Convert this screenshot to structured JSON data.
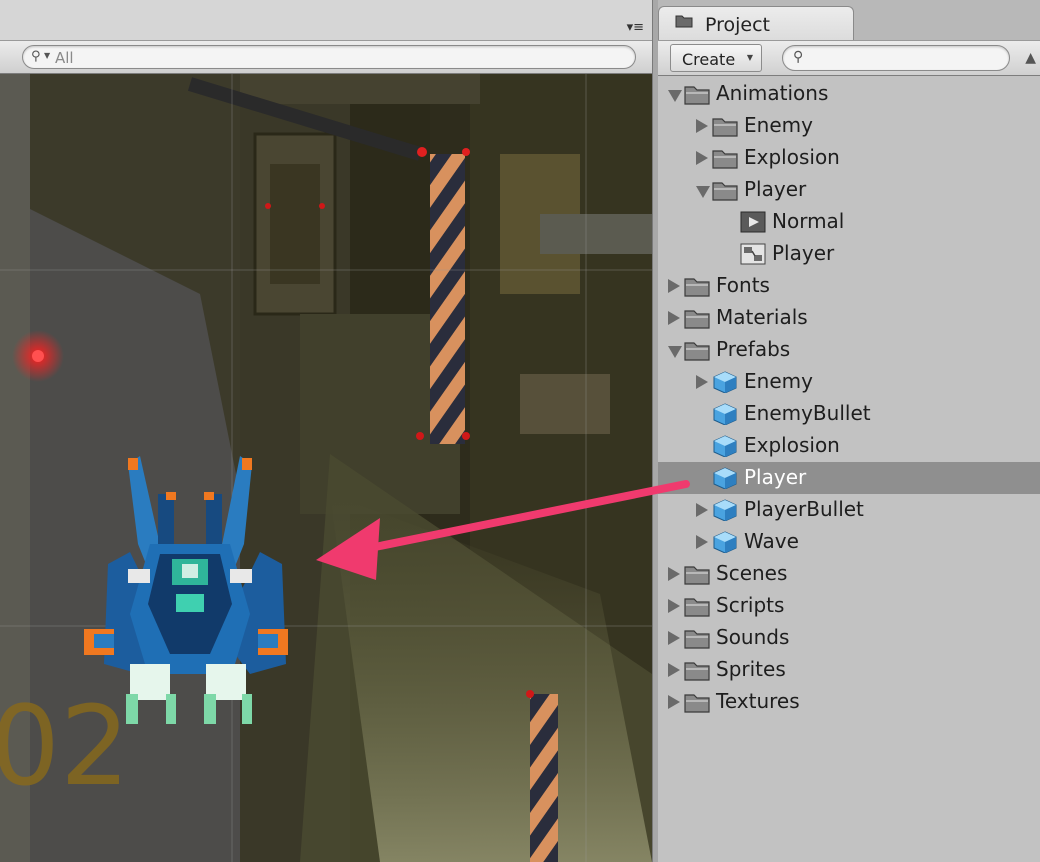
{
  "scene": {
    "search_placeholder": "All",
    "panel_menu": "▾≡",
    "runway_marking": "02"
  },
  "project": {
    "tab_label": "Project",
    "create_label": "Create",
    "search_placeholder": "",
    "tree": [
      {
        "label": "Animations",
        "depth": 0,
        "icon": "folder-icon",
        "toggle": "open"
      },
      {
        "label": "Enemy",
        "depth": 1,
        "icon": "folder-icon",
        "toggle": "closed"
      },
      {
        "label": "Explosion",
        "depth": 1,
        "icon": "folder-icon",
        "toggle": "closed"
      },
      {
        "label": "Player",
        "depth": 1,
        "icon": "folder-icon",
        "toggle": "open"
      },
      {
        "label": "Normal",
        "depth": 2,
        "icon": "animation-clip-icon",
        "toggle": "none"
      },
      {
        "label": "Player",
        "depth": 2,
        "icon": "animator-controller-icon",
        "toggle": "none"
      },
      {
        "label": "Fonts",
        "depth": 0,
        "icon": "folder-icon",
        "toggle": "closed"
      },
      {
        "label": "Materials",
        "depth": 0,
        "icon": "folder-icon",
        "toggle": "closed"
      },
      {
        "label": "Prefabs",
        "depth": 0,
        "icon": "folder-icon",
        "toggle": "open"
      },
      {
        "label": "Enemy",
        "depth": 1,
        "icon": "prefab-cube-icon",
        "toggle": "closed"
      },
      {
        "label": "EnemyBullet",
        "depth": 1,
        "icon": "prefab-cube-icon",
        "toggle": "none"
      },
      {
        "label": "Explosion",
        "depth": 1,
        "icon": "prefab-cube-icon",
        "toggle": "none"
      },
      {
        "label": "Player",
        "depth": 1,
        "icon": "prefab-cube-icon",
        "toggle": "none",
        "selected": true
      },
      {
        "label": "PlayerBullet",
        "depth": 1,
        "icon": "prefab-cube-icon",
        "toggle": "closed"
      },
      {
        "label": "Wave",
        "depth": 1,
        "icon": "prefab-cube-icon",
        "toggle": "closed"
      },
      {
        "label": "Scenes",
        "depth": 0,
        "icon": "folder-icon",
        "toggle": "closed"
      },
      {
        "label": "Scripts",
        "depth": 0,
        "icon": "folder-icon",
        "toggle": "closed"
      },
      {
        "label": "Sounds",
        "depth": 0,
        "icon": "folder-icon",
        "toggle": "closed"
      },
      {
        "label": "Sprites",
        "depth": 0,
        "icon": "folder-icon",
        "toggle": "closed"
      },
      {
        "label": "Textures",
        "depth": 0,
        "icon": "folder-icon",
        "toggle": "closed"
      }
    ]
  },
  "colors": {
    "selection": "#8f8f8f",
    "arrow": "#f03a6e",
    "prefab_blue": "#4aa3e0"
  }
}
